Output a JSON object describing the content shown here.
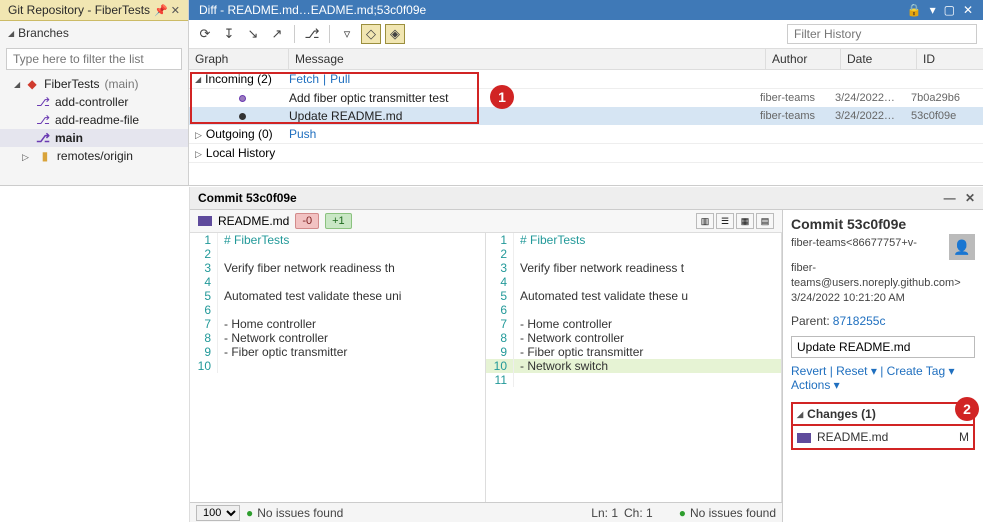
{
  "leftTab": {
    "title": "Git Repository - FiberTests"
  },
  "branchesHeader": "Branches",
  "filterPlaceholder": "Type here to filter the list",
  "repo": {
    "name": "FiberTests",
    "current": "(main)"
  },
  "branches": {
    "addController": "add-controller",
    "addReadme": "add-readme-file",
    "main": "main",
    "remotes": "remotes/origin"
  },
  "titleBar": {
    "text": "Diff - README.md…EADME.md;53c0f09e"
  },
  "historyPlaceholder": "Filter History",
  "gridHeaders": {
    "graph": "Graph",
    "message": "Message",
    "author": "Author",
    "date": "Date",
    "id": "ID"
  },
  "sections": {
    "incoming": {
      "label": "Incoming (2)",
      "fetch": "Fetch",
      "pull": "Pull"
    },
    "outgoing": {
      "label": "Outgoing (0)",
      "push": "Push"
    },
    "local": {
      "label": "Local History"
    }
  },
  "commits": [
    {
      "msg": "Add fiber optic transmitter test",
      "author": "fiber-teams",
      "date": "3/24/2022…",
      "id": "7b0a29b6"
    },
    {
      "msg": "Update README.md",
      "author": "fiber-teams",
      "date": "3/24/2022…",
      "id": "53c0f09e"
    }
  ],
  "commitPanel": {
    "header": "Commit 53c0f09e",
    "filename": "README.md",
    "removed": "-0",
    "added": "+1",
    "left": {
      "lines": [
        {
          "n": "1",
          "t": "# FiberTests",
          "cls": "comment"
        },
        {
          "n": "2",
          "t": ""
        },
        {
          "n": "3",
          "t": "Verify fiber network readiness th"
        },
        {
          "n": "4",
          "t": ""
        },
        {
          "n": "5",
          "t": "Automated test validate these uni"
        },
        {
          "n": "6",
          "t": ""
        },
        {
          "n": "7",
          "t": "- Home controller"
        },
        {
          "n": "8",
          "t": "- Network controller"
        },
        {
          "n": "9",
          "t": "- Fiber optic transmitter"
        },
        {
          "n": "",
          "t": "",
          "hatch": true
        },
        {
          "n": "10",
          "t": ""
        }
      ]
    },
    "right": {
      "lines": [
        {
          "n": "1",
          "t": "# FiberTests",
          "cls": "comment"
        },
        {
          "n": "2",
          "t": ""
        },
        {
          "n": "3",
          "t": "Verify fiber network readiness t"
        },
        {
          "n": "4",
          "t": ""
        },
        {
          "n": "5",
          "t": "Automated test validate these u"
        },
        {
          "n": "6",
          "t": ""
        },
        {
          "n": "7",
          "t": "- Home controller"
        },
        {
          "n": "8",
          "t": "- Network controller"
        },
        {
          "n": "9",
          "t": "- Fiber optic transmitter"
        },
        {
          "n": "10",
          "t": "- Network switch",
          "added": true
        },
        {
          "n": "11",
          "t": ""
        }
      ]
    }
  },
  "statusBar": {
    "zoom": "100 %",
    "issues": "No issues found",
    "ln": "Ln: 1",
    "ch": "Ch: 1",
    "issues2": "No issues found"
  },
  "details": {
    "header": "Commit 53c0f09e",
    "authorLine": "fiber-teams<86677757+v-",
    "email": "fiber-teams@users.noreply.github.com>",
    "datetime": "3/24/2022 10:21:20 AM",
    "parentLabel": "Parent:",
    "parent": "8718255c",
    "message": "Update README.md",
    "revert": "Revert",
    "reset": "Reset ▾",
    "createTag": "Create Tag ▾",
    "actions": "Actions ▾",
    "changesLabel": "Changes (1)",
    "changedFile": "README.md",
    "changedMark": "M"
  }
}
